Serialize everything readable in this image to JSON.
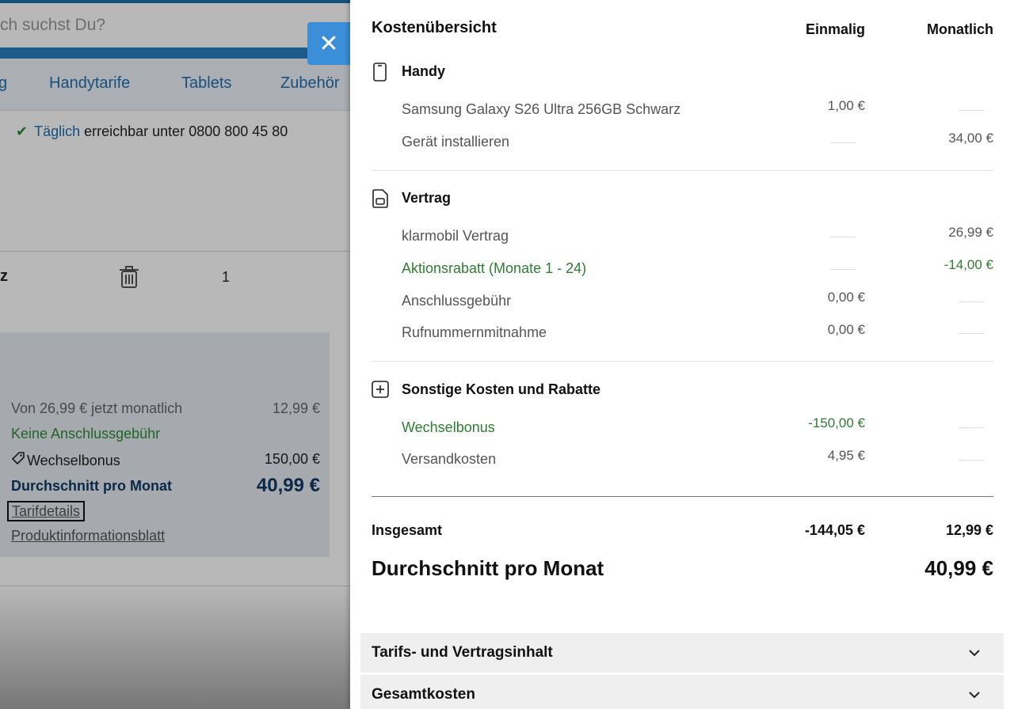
{
  "background_page": {
    "search_placeholder": "ch suchst Du?",
    "nav_items": [
      {
        "label": "g"
      },
      {
        "label": "Handytarife"
      },
      {
        "label": "Tablets"
      },
      {
        "label": "Zubehör"
      }
    ],
    "hotline": {
      "highlight": "Täglich",
      "text": " erreichbar unter 0800 800 45 80"
    },
    "product_name_fragment": "z",
    "quantity": "1",
    "tariff_box": {
      "monthly_label": "Von 26,99 € jetzt monatlich",
      "monthly_value": "12,99 €",
      "no_fee_label": "Keine Anschlussgebühr",
      "bonus_label": "Wechselbonus",
      "bonus_value": "150,00 €",
      "avg_label": "Durchschnitt pro Monat",
      "avg_value": "40,99 €",
      "link_tarifdetails": "Tarifdetails",
      "link_produktinfo": "Produktinformationsblatt"
    }
  },
  "drawer": {
    "close_label": "✕",
    "title": "Kostenübersicht",
    "col_once": "Einmalig",
    "col_monthly": "Monatlich",
    "sections": {
      "handy": {
        "title": "Handy",
        "items": [
          {
            "label": "Samsung Galaxy S26 Ultra 256GB Schwarz",
            "once": "1,00 €",
            "monthly": ""
          },
          {
            "label": "Gerät installieren",
            "once": "",
            "monthly": "34,00 €"
          }
        ]
      },
      "vertrag": {
        "title": "Vertrag",
        "items": [
          {
            "label": "klarmobil Vertrag",
            "once": "",
            "monthly": "26,99 €"
          },
          {
            "label": "Aktionsrabatt (Monate 1 - 24)",
            "once": "",
            "monthly": "-14,00 €"
          },
          {
            "label": "Anschlussgebühr",
            "once": "0,00 €",
            "monthly": ""
          },
          {
            "label": "Rufnummernmitnahme",
            "once": "0,00 €",
            "monthly": ""
          }
        ]
      },
      "sonstige": {
        "title": "Sonstige Kosten und Rabatte",
        "items": [
          {
            "label": "Wechselbonus",
            "once": "-150,00 €",
            "monthly": ""
          },
          {
            "label": "Versandkosten",
            "once": "4,95 €",
            "monthly": ""
          }
        ]
      }
    },
    "total": {
      "label": "Insgesamt",
      "once": "-144,05 €",
      "monthly": "12,99 €"
    },
    "average": {
      "label": "Durchschnitt pro Monat",
      "value": "40,99 €"
    },
    "accordions": [
      {
        "label": "Tarifs- und Vertragsinhalt"
      },
      {
        "label": "Gesamtkosten"
      }
    ]
  },
  "colors": {
    "accent": "#3b8fd8",
    "link": "#1f6fae",
    "discount": "#2e7d32",
    "navy": "#0e3a66"
  },
  "icons": [
    "phone-icon",
    "sim-card-icon",
    "plus-square-icon",
    "chevron-down-icon",
    "close-icon",
    "trash-icon",
    "tag-icon",
    "checkmark-icon"
  ]
}
